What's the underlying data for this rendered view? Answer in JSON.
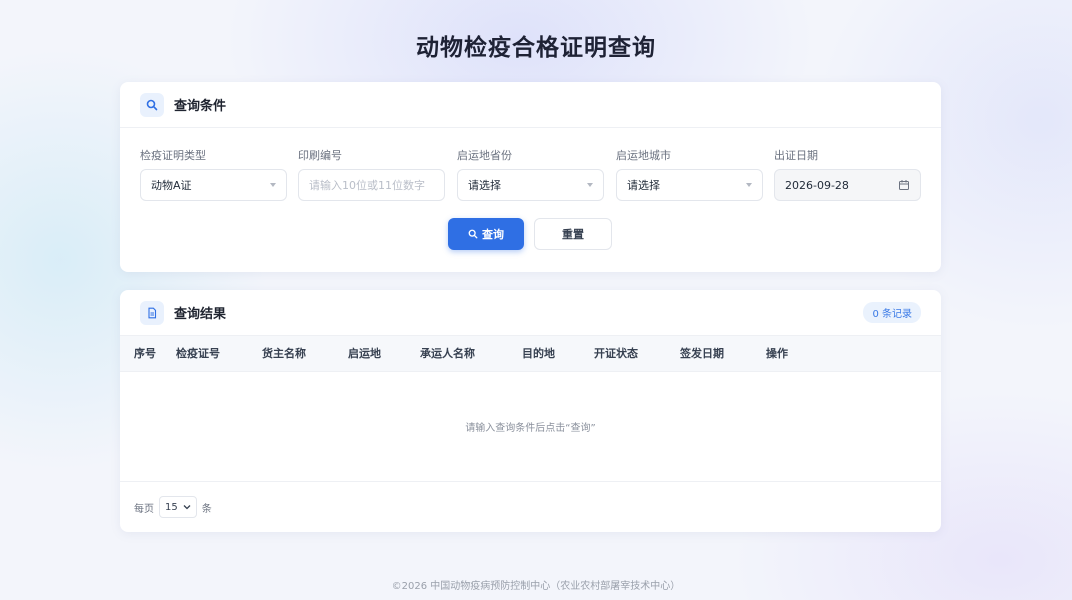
{
  "page": {
    "title": "动物检疫合格证明查询"
  },
  "search": {
    "title": "查询条件",
    "fields": [
      {
        "label": "检疫证明类型",
        "value": "动物A证"
      },
      {
        "label": "印刷编号",
        "placeholder": "请输入10位或11位数字"
      },
      {
        "label": "启运地省份",
        "value": "请选择"
      },
      {
        "label": "启运地城市",
        "value": "请选择"
      },
      {
        "label": "出证日期",
        "value": "2026-09-28"
      }
    ],
    "query_button": "查询",
    "reset_button": "重置"
  },
  "results": {
    "title": "查询结果",
    "count_badge": "0 条记录",
    "columns": [
      "序号",
      "检疫证号",
      "货主名称",
      "启运地",
      "承运人名称",
      "目的地",
      "开证状态",
      "签发日期",
      "操作"
    ],
    "empty_text": "请输入查询条件后点击“查询”",
    "pager": {
      "prefix": "每页",
      "page_size": "15",
      "suffix": "条"
    }
  },
  "footer": {
    "text": "©2026 中国动物疫病预防控制中心（农业农村部屠宰技术中心）"
  },
  "colors": {
    "accent": "#2f6fe4",
    "background": "#f3f5fb",
    "card": "#ffffff"
  },
  "icons": [
    "search-icon",
    "document-icon",
    "calendar-icon",
    "chevron-down-icon"
  ]
}
